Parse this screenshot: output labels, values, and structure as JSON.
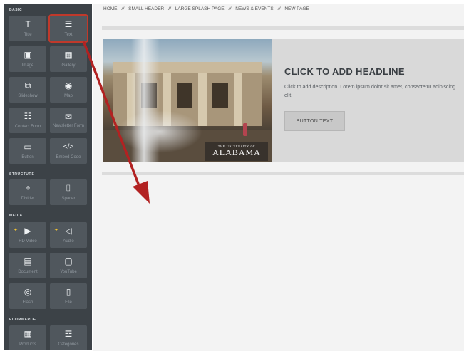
{
  "sidebar": {
    "sections": {
      "basic": "BASIC",
      "structure": "STRUCTURE",
      "media": "MEDIA",
      "ecommerce": "ECOMMERCE"
    },
    "items": [
      {
        "label": "Title",
        "icon": "title-icon",
        "glyph": "T"
      },
      {
        "label": "Text",
        "icon": "text-icon",
        "glyph": "☰"
      },
      {
        "label": "Image",
        "icon": "image-icon",
        "glyph": "▣"
      },
      {
        "label": "Gallery",
        "icon": "gallery-icon",
        "glyph": "▦"
      },
      {
        "label": "Slideshow",
        "icon": "slideshow-icon",
        "glyph": "⧉"
      },
      {
        "label": "Map",
        "icon": "map-icon",
        "glyph": "◉"
      },
      {
        "label": "Contact Form",
        "icon": "contact-form-icon",
        "glyph": "☷"
      },
      {
        "label": "Newsletter Form",
        "icon": "newsletter-icon",
        "glyph": "✉"
      },
      {
        "label": "Button",
        "icon": "button-icon",
        "glyph": "▭"
      },
      {
        "label": "Embed Code",
        "icon": "embed-code-icon",
        "glyph": "</>"
      },
      {
        "label": "Divider",
        "icon": "divider-icon",
        "glyph": "÷"
      },
      {
        "label": "Spacer",
        "icon": "spacer-icon",
        "glyph": "⌷"
      },
      {
        "label": "HD Video",
        "icon": "video-icon",
        "glyph": "▶"
      },
      {
        "label": "Audio",
        "icon": "audio-icon",
        "glyph": "◁"
      },
      {
        "label": "Document",
        "icon": "document-icon",
        "glyph": "▤"
      },
      {
        "label": "YouTube",
        "icon": "youtube-icon",
        "glyph": "▢"
      },
      {
        "label": "Flash",
        "icon": "flash-icon",
        "glyph": "◎"
      },
      {
        "label": "File",
        "icon": "file-icon",
        "glyph": "▯"
      },
      {
        "label": "Products",
        "icon": "products-icon",
        "glyph": "▦"
      },
      {
        "label": "Categories",
        "icon": "categories-icon",
        "glyph": "☲"
      }
    ]
  },
  "breadcrumb": {
    "items": [
      "HOME",
      "SMALL HEADER",
      "LARGE SPLASH PAGE",
      "NEWS & EVENTS",
      "NEW PAGE"
    ],
    "separator": "//"
  },
  "splash": {
    "logo_small": "THE UNIVERSITY OF",
    "logo_big": "ALABAMA",
    "headline": "CLICK TO ADD HEADLINE",
    "description": "Click to add description. Lorem ipsum dolor sit amet, consectetur adipiscing elit.",
    "button_text": "BUTTON TEXT"
  },
  "colors": {
    "sidebar_bg": "#3c4247",
    "tile_bg": "#50575d",
    "highlight": "#c0392b",
    "arrow": "#b22222",
    "premium_star": "#f1c232"
  }
}
